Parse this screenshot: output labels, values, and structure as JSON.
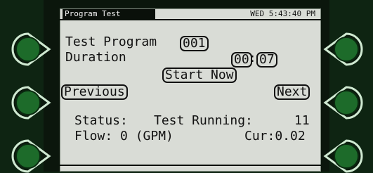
{
  "header": {
    "title": "Program Test",
    "clock": "WED 5:43:40 PM"
  },
  "program": {
    "label": "Test Program",
    "number": "001"
  },
  "duration": {
    "label": "Duration",
    "minutes": "00",
    "separator": ":",
    "seconds": "07"
  },
  "buttons": {
    "start": "Start Now",
    "previous": "Previous",
    "next": "Next"
  },
  "status": {
    "line1_label": "Status:",
    "line1_value": "Test Running:",
    "line1_count": "11",
    "flow": "Flow: 0 (GPM)",
    "current": "Cur:0.02"
  },
  "colors": {
    "background": "#0e2412",
    "screen": "#d9dcd6",
    "button_ring": "#bde3c2",
    "button_face": "#1f6f2c"
  },
  "side_buttons": [
    {
      "icon": "soft-key-left-1"
    },
    {
      "icon": "soft-key-left-2"
    },
    {
      "icon": "soft-key-left-3"
    },
    {
      "icon": "soft-key-right-1"
    },
    {
      "icon": "soft-key-right-2"
    },
    {
      "icon": "soft-key-right-3"
    }
  ]
}
